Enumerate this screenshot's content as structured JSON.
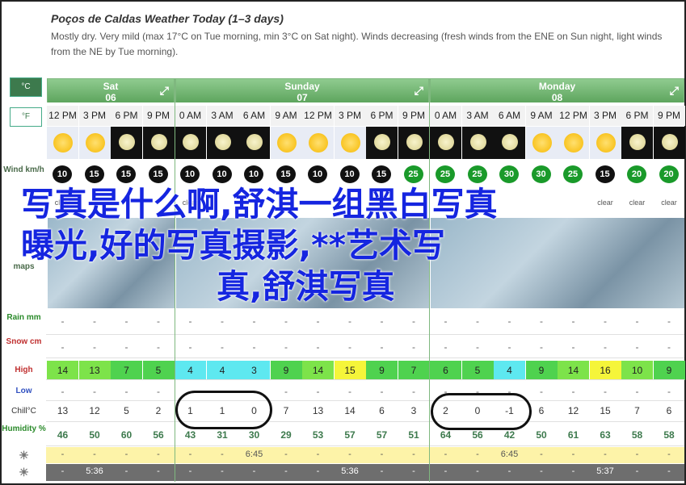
{
  "header": {
    "title": "Poços de Caldas Weather Today (1–3 days)",
    "description": "Mostly dry. Very mild (max 17°C on Tue morning, min 3°C on Sat night). Winds decreasing (fresh winds from the ENE on Sun night, light winds from the NE by Tue morning)."
  },
  "units": {
    "celsius": "°C",
    "fahrenheit": "°F"
  },
  "labels": {
    "wind": "Wind km/h",
    "maps": "maps",
    "rain": "Rain mm",
    "snow": "Snow cm",
    "high": "High",
    "low": "Low",
    "chill": "Chill°C",
    "humidity": "Humidity %"
  },
  "days": [
    {
      "name": "Sat",
      "date": "06"
    },
    {
      "name": "Sunday",
      "date": "07"
    },
    {
      "name": "Monday",
      "date": "08"
    }
  ],
  "hours": [
    "12 PM",
    "3 PM",
    "6 PM",
    "9 PM",
    "0 AM",
    "3 AM",
    "6 AM",
    "9 AM",
    "12 PM",
    "3 PM",
    "6 PM",
    "9 PM",
    "0 AM",
    "3 AM",
    "6 AM",
    "9 AM",
    "12 PM",
    "3 PM",
    "6 PM",
    "9 PM"
  ],
  "sky": [
    "sun",
    "sun",
    "moon",
    "moon",
    "moon",
    "moon",
    "moon",
    "sun",
    "sun",
    "sun",
    "moon",
    "moon",
    "moon",
    "moon",
    "moon",
    "sun",
    "sun",
    "sun",
    "moon",
    "moon"
  ],
  "wind": [
    "10",
    "15",
    "15",
    "15",
    "10",
    "10",
    "10",
    "15",
    "10",
    "10",
    "15",
    "25",
    "25",
    "25",
    "30",
    "30",
    "25",
    "15",
    "20",
    "20"
  ],
  "wind_colors": [
    "black",
    "black",
    "black",
    "black",
    "black",
    "black",
    "black",
    "black",
    "black",
    "black",
    "black",
    "green",
    "green",
    "green",
    "green",
    "green",
    "green",
    "black",
    "green",
    "green"
  ],
  "wind_text": [
    "clear",
    "",
    "",
    "",
    "clear",
    "",
    "",
    "",
    "",
    "",
    "",
    "",
    "",
    "",
    "",
    "",
    "",
    "clear",
    "clear",
    "clear"
  ],
  "rain": [
    "-",
    "-",
    "-",
    "-",
    "-",
    "-",
    "-",
    "-",
    "-",
    "-",
    "-",
    "-",
    "-",
    "-",
    "-",
    "-",
    "-",
    "-",
    "-",
    "-"
  ],
  "snow": [
    "-",
    "-",
    "-",
    "-",
    "-",
    "-",
    "-",
    "-",
    "-",
    "-",
    "-",
    "-",
    "-",
    "-",
    "-",
    "-",
    "-",
    "-",
    "-",
    "-"
  ],
  "high": [
    "14",
    "13",
    "7",
    "5",
    "4",
    "4",
    "3",
    "9",
    "14",
    "15",
    "9",
    "7",
    "6",
    "5",
    "4",
    "9",
    "14",
    "16",
    "10",
    "9"
  ],
  "high_colors": [
    "#7de34a",
    "#7de34a",
    "#4fd24f",
    "#4fd24f",
    "#5ee8f0",
    "#5ee8f0",
    "#5ee8f0",
    "#4fd24f",
    "#7de34a",
    "#f5f53a",
    "#4fd24f",
    "#4fd24f",
    "#4fd24f",
    "#4fd24f",
    "#5ee8f0",
    "#4fd24f",
    "#7de34a",
    "#f5f53a",
    "#7de34a",
    "#4fd24f"
  ],
  "low": [
    "-",
    "-",
    "-",
    "-",
    "-",
    "-",
    "-",
    "-",
    "-",
    "-",
    "-",
    "-",
    "-",
    "-",
    "-",
    "-",
    "-",
    "-",
    "-",
    "-"
  ],
  "chill": [
    "13",
    "12",
    "5",
    "2",
    "1",
    "1",
    "0",
    "7",
    "13",
    "14",
    "6",
    "3",
    "2",
    "0",
    "-1",
    "6",
    "12",
    "15",
    "7",
    "6"
  ],
  "humidity": [
    "46",
    "50",
    "60",
    "56",
    "43",
    "31",
    "30",
    "29",
    "53",
    "57",
    "57",
    "51",
    "64",
    "56",
    "42",
    "50",
    "61",
    "63",
    "58",
    "58"
  ],
  "sunrise": [
    "-",
    "-",
    "-",
    "-",
    "-",
    "-",
    "6:45",
    "-",
    "-",
    "-",
    "-",
    "-",
    "-",
    "-",
    "6:45",
    "-",
    "-",
    "-",
    "-",
    "-"
  ],
  "sunset": [
    "-",
    "5:36",
    "-",
    "-",
    "-",
    "-",
    "-",
    "-",
    "-",
    "5:36",
    "-",
    "-",
    "-",
    "-",
    "-",
    "-",
    "-",
    "5:37",
    "-",
    "-"
  ],
  "overlay": {
    "line1": "写真是什么啊,舒淇一组黑白写真",
    "line2": "曝光,好的写真摄影,**艺术写",
    "line3": "真,舒淇写真"
  }
}
